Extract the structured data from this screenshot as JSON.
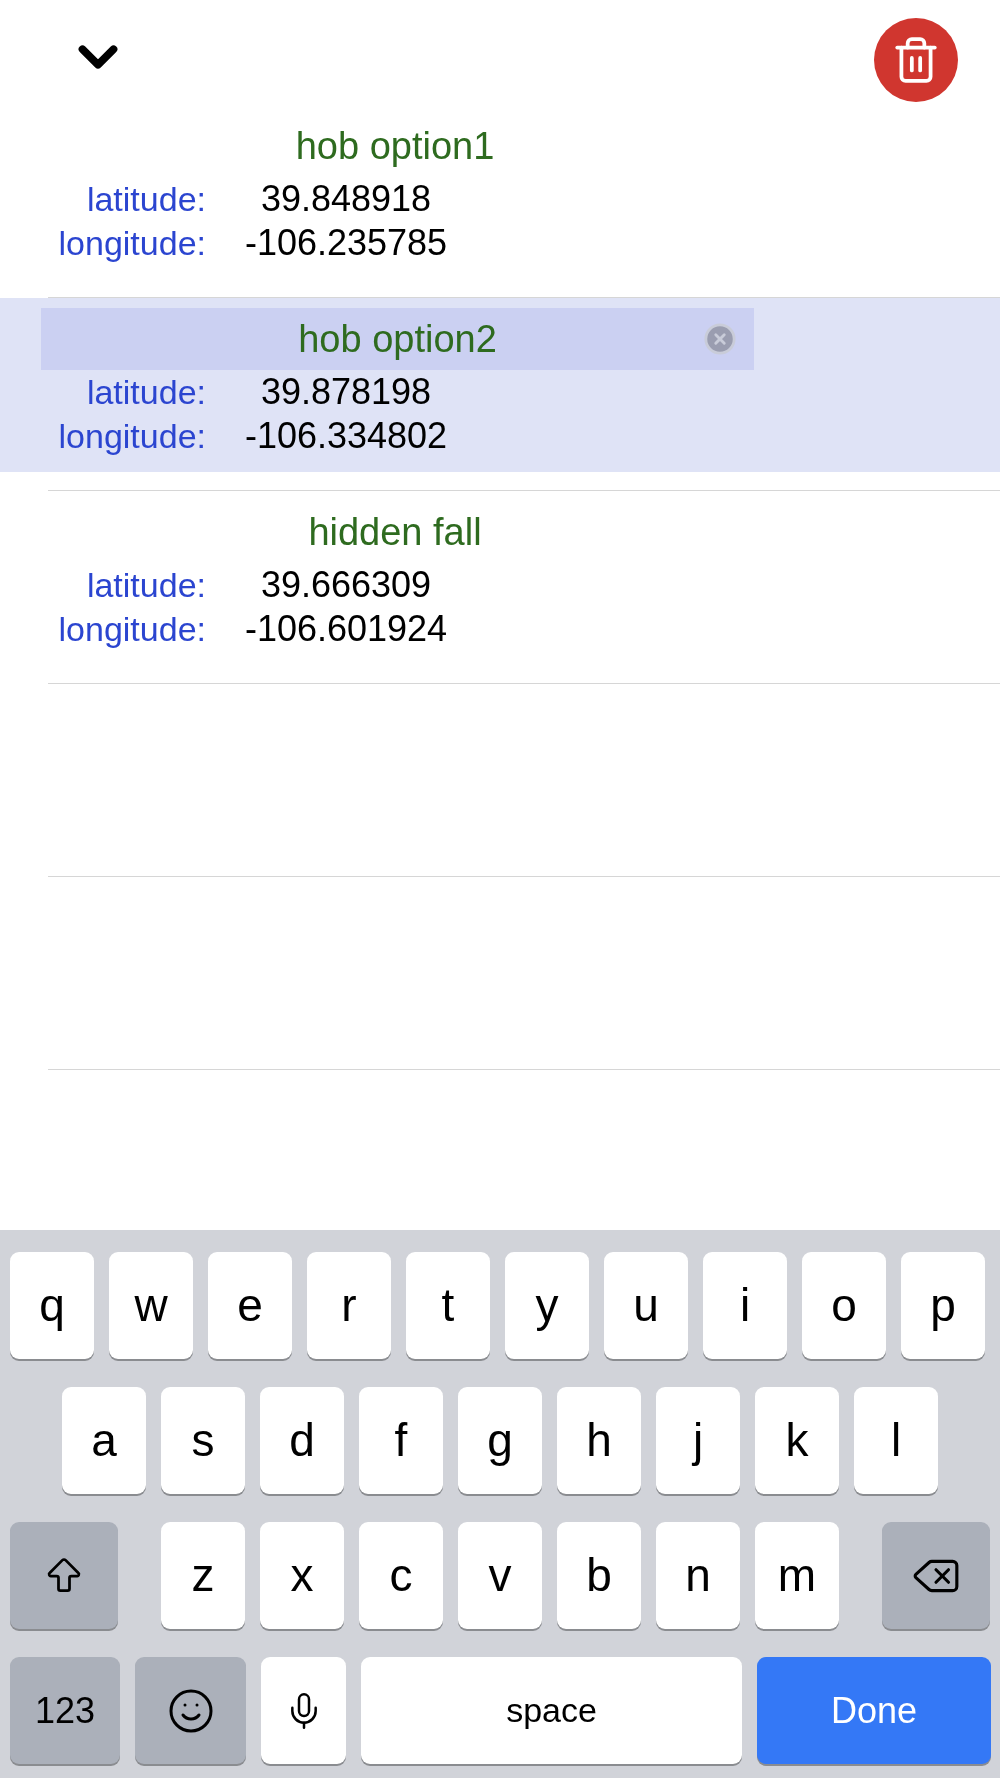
{
  "locations": [
    {
      "name": "hob option1",
      "latitude_label": "latitude:",
      "latitude": "39.848918",
      "longitude_label": "longitude:",
      "longitude": "-106.235785",
      "selected": false
    },
    {
      "name": "hob option2",
      "latitude_label": "latitude:",
      "latitude": "39.878198",
      "longitude_label": "longitude:",
      "longitude": "-106.334802",
      "selected": true
    },
    {
      "name": "hidden fall",
      "latitude_label": "latitude:",
      "latitude": "39.666309",
      "longitude_label": "longitude:",
      "longitude": "-106.601924",
      "selected": false
    }
  ],
  "keyboard": {
    "rows": [
      {
        "keys": [
          {
            "kind": "letter",
            "label": "q"
          },
          {
            "kind": "letter",
            "label": "w"
          },
          {
            "kind": "letter",
            "label": "e"
          },
          {
            "kind": "letter",
            "label": "r"
          },
          {
            "kind": "letter",
            "label": "t"
          },
          {
            "kind": "letter",
            "label": "y"
          },
          {
            "kind": "letter",
            "label": "u"
          },
          {
            "kind": "letter",
            "label": "i"
          },
          {
            "kind": "letter",
            "label": "o"
          },
          {
            "kind": "letter",
            "label": "p"
          }
        ]
      },
      {
        "keys": [
          {
            "kind": "letter",
            "label": "a"
          },
          {
            "kind": "letter",
            "label": "s"
          },
          {
            "kind": "letter",
            "label": "d"
          },
          {
            "kind": "letter",
            "label": "f"
          },
          {
            "kind": "letter",
            "label": "g"
          },
          {
            "kind": "letter",
            "label": "h"
          },
          {
            "kind": "letter",
            "label": "j"
          },
          {
            "kind": "letter",
            "label": "k"
          },
          {
            "kind": "letter",
            "label": "l"
          }
        ]
      },
      {
        "keys": [
          {
            "kind": "shift"
          },
          {
            "kind": "letter",
            "label": "z"
          },
          {
            "kind": "letter",
            "label": "x"
          },
          {
            "kind": "letter",
            "label": "c"
          },
          {
            "kind": "letter",
            "label": "v"
          },
          {
            "kind": "letter",
            "label": "b"
          },
          {
            "kind": "letter",
            "label": "n"
          },
          {
            "kind": "letter",
            "label": "m"
          },
          {
            "kind": "delete"
          }
        ]
      },
      {
        "keys": [
          {
            "kind": "numbers",
            "label": "123"
          },
          {
            "kind": "emoji"
          },
          {
            "kind": "mic"
          },
          {
            "kind": "space",
            "label": "space"
          },
          {
            "kind": "done",
            "label": "Done"
          }
        ]
      }
    ]
  }
}
